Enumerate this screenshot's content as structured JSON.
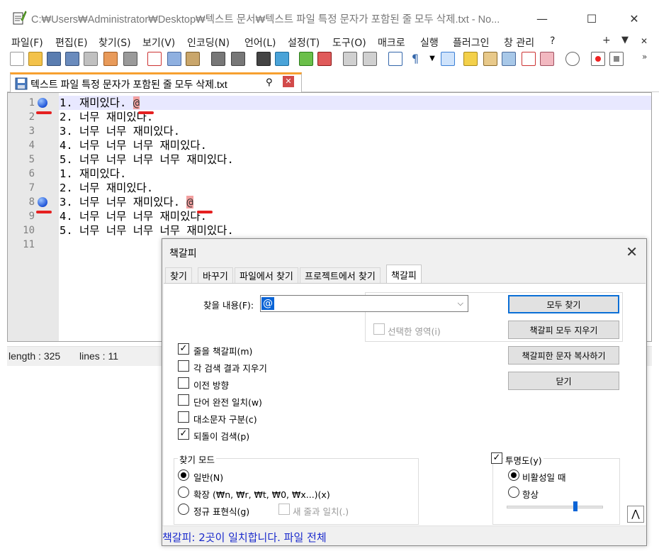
{
  "window": {
    "title": "C:₩Users₩Administrator₩Desktop₩텍스트 문서₩텍스트 파일 특정 문자가 포함된 줄 모두 삭제.txt - No...",
    "minimize": "—",
    "maximize": "☐",
    "close": "✕"
  },
  "menu": {
    "items": [
      "파일(F)",
      "편집(E)",
      "찾기(S)",
      "보기(V)",
      "인코딩(N)",
      "언어(L)",
      "설정(T)",
      "도구(O)",
      "매크로",
      "실행",
      "플러그인",
      "창 관리",
      "?"
    ],
    "right": [
      "+",
      "▼",
      "✕"
    ]
  },
  "tab": {
    "label": "텍스트 파일 특정 문자가 포함된 줄 모두 삭제.txt",
    "pin": "📌",
    "close": "✖"
  },
  "editor": {
    "line_numbers": [
      "1",
      "2",
      "3",
      "4",
      "5",
      "6",
      "7",
      "8",
      "9",
      "10",
      "11"
    ],
    "lines": [
      "1. 재미있다. @",
      "2. 너무 재미있다.",
      "3. 너무 너무 재미있다.",
      "4. 너무 너무 너무 재미있다.",
      "5. 너무 너무 너무 너무 재미있다.",
      "1. 재미있다.",
      "2. 너무 재미있다.",
      "3. 너무 너무 재미있다. @",
      "4. 너무 너무 너무 재미있다.",
      "5. 너무 너무 너무 너무 재미있다.",
      ""
    ],
    "line1_text": "1. 재미있다. ",
    "line8_text": "3. 너무 너무 재미있다. ",
    "at": "@"
  },
  "status": {
    "length": "length : 325",
    "lines": "lines : 11"
  },
  "dialog": {
    "title": "책갈피",
    "close": "✕",
    "tabs": [
      "찾기",
      "바꾸기",
      "파일에서 찾기",
      "프로젝트에서 찾기",
      "책갈피"
    ],
    "find_label": "찾을 내용(F):",
    "find_value": "@",
    "in_selection": "선택한 영역(i)",
    "buttons": {
      "find_all": "모두 찾기",
      "clear_bookmarks": "책갈피 모두 지우기",
      "copy_bookmarked": "책갈피한 문자 복사하기",
      "close": "닫기"
    },
    "options": [
      {
        "label": "줄을 책갈피(m)",
        "checked": true
      },
      {
        "label": "각 검색 결과 지우기",
        "checked": false
      },
      {
        "label": "이전 방향",
        "checked": false
      },
      {
        "label": "단어 완전 일치(w)",
        "checked": false
      },
      {
        "label": "대소문자 구분(c)",
        "checked": false
      },
      {
        "label": "되돌이 검색(p)",
        "checked": true
      }
    ],
    "search_mode": {
      "title": "찾기 모드",
      "normal": "일반(N)",
      "extended": "확장 (₩n, ₩r, ₩t, ₩0, ₩x...)(x)",
      "regex": "정규 표현식(g)",
      "dot_newline": "새 줄과 일치(.)",
      "selected": "normal"
    },
    "transparency": {
      "label": "투명도(y)",
      "checked": true,
      "on_lose_focus": "비활성일 때",
      "always": "항상",
      "selected": "on_lose_focus",
      "level": 0.71
    },
    "collapse": "⋀",
    "status_text": "책갈피: 2곳이 일치합니다. 파일 전체"
  }
}
